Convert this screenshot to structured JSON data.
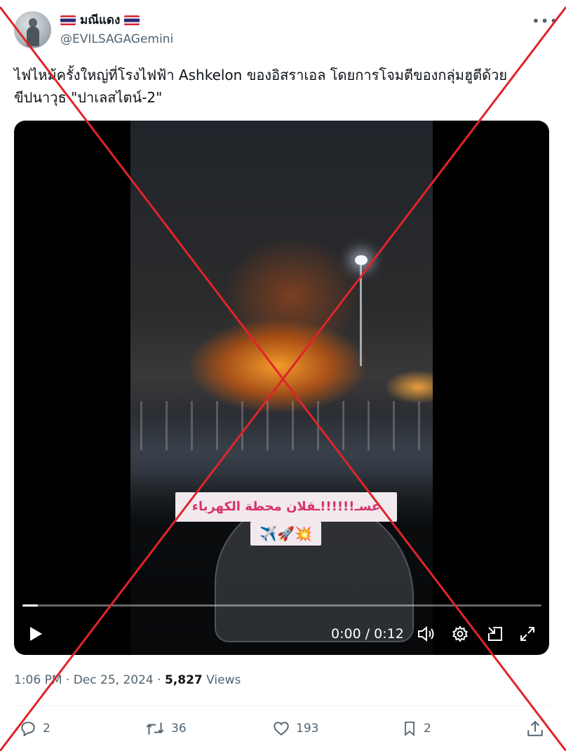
{
  "author": {
    "display_name": "มณีแดง",
    "handle": "@EVILSAGAGemini",
    "flag_icon": "thailand-flag-icon"
  },
  "more_icon": "more-options-icon",
  "tweet": {
    "text": "ไฟไหม้ครั้งใหญ่ที่โรงไฟฟ้า Ashkelon ของอิสราเอล โดยการโจมตีของกลุ่มฮูตีด้วยขีปนาวุธ \"ปาเลสไตน์-2\""
  },
  "video": {
    "caption_text": "عسـ!!!!!!ـقلان محطة الكهرباء",
    "caption_emojis": "✈️🚀💥",
    "time_display": "0:00 / 0:12",
    "progress": 0.03,
    "controls": {
      "play_icon": "play-icon",
      "volume_icon": "volume-icon",
      "settings_icon": "gear-icon",
      "minimize_icon": "picture-in-picture-icon",
      "fullscreen_icon": "fullscreen-icon"
    }
  },
  "meta": {
    "time": "1:06 PM",
    "separator": "·",
    "date": "Dec 25, 2024",
    "views_count": "5,827",
    "views_label": "Views"
  },
  "actions": {
    "replies": "2",
    "reposts": "36",
    "likes": "193",
    "bookmarks": "2"
  },
  "overlay": {
    "type": "red-x-cross",
    "color": "#e0242b"
  }
}
